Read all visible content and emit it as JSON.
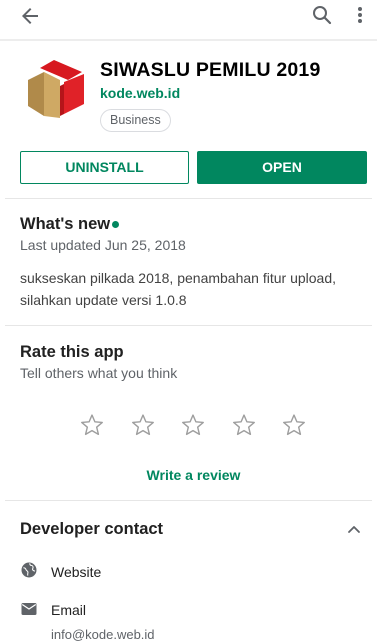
{
  "app": {
    "title": "SIWASLU PEMILU 2019",
    "developer": "kode.web.id",
    "category": "Business"
  },
  "actions": {
    "uninstall_label": "UNINSTALL",
    "open_label": "OPEN"
  },
  "whats_new": {
    "title": "What's new",
    "last_updated": "Last updated Jun 25, 2018",
    "notes": "sukseskan pilkada 2018, penambahan fitur upload, silahkan update versi 1.0.8"
  },
  "rate": {
    "title": "Rate this app",
    "subtitle": "Tell others what you think",
    "rating": 0,
    "max_stars": 5,
    "write_review_label": "Write a review"
  },
  "developer_contact": {
    "title": "Developer contact",
    "items": [
      {
        "icon": "globe-icon",
        "label": "Website",
        "value": ""
      },
      {
        "icon": "mail-icon",
        "label": "Email",
        "value": "info@kode.web.id"
      }
    ]
  },
  "colors": {
    "accent": "#01875f",
    "text": "#212121",
    "secondary": "#5f6368"
  }
}
